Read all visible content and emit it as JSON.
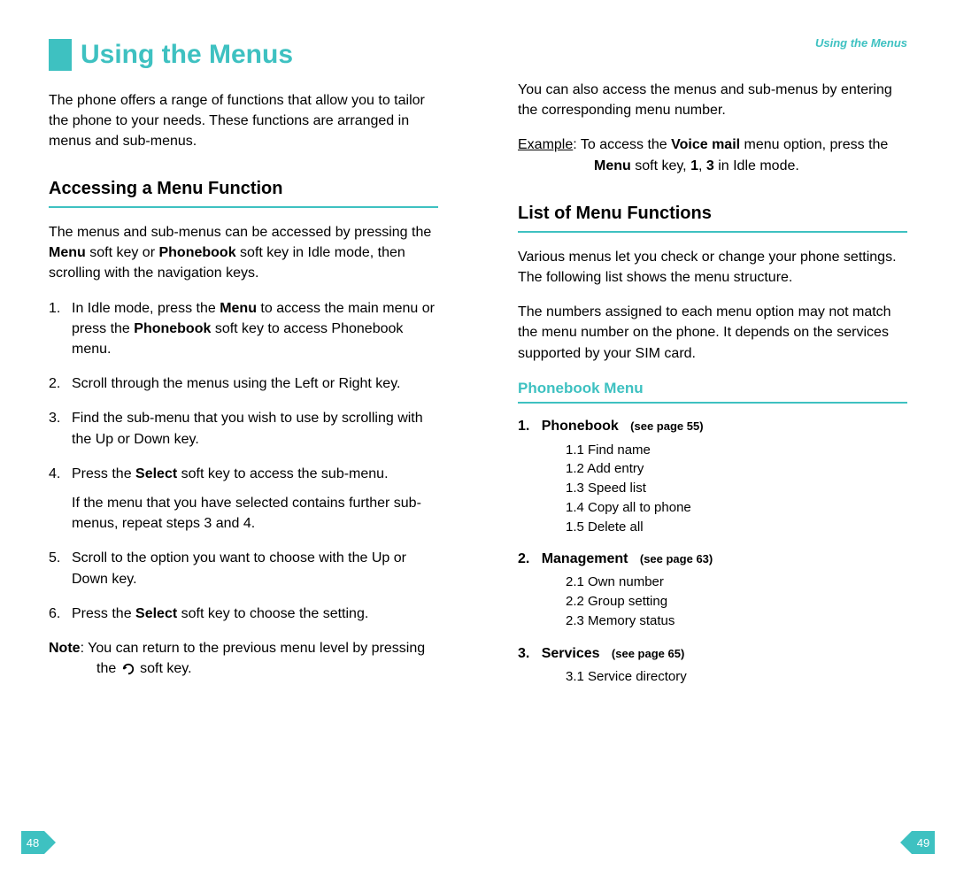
{
  "left": {
    "title": "Using the Menus",
    "intro": "The phone offers a range of functions that allow you to tailor the phone to your needs. These functions are arranged in menus and sub-menus.",
    "section_title": "Accessing a Menu Function",
    "access_para_prefix": "The menus and sub-menus can be accessed by pressing the ",
    "access_para_menu_bold": "Menu",
    "access_para_mid1": " soft key or ",
    "access_para_phonebook_bold": "Phonebook",
    "access_para_suffix": " soft key in Idle mode, then scrolling with the navigation keys.",
    "steps": [
      {
        "n": "1.",
        "pre": "In Idle mode, press the ",
        "b1": "Menu",
        "mid": " to access the main menu or press the ",
        "b2": "Phonebook",
        "post": " soft key to access Phonebook menu."
      },
      {
        "n": "2.",
        "text": "Scroll through the menus using the Left or Right key."
      },
      {
        "n": "3.",
        "text": "Find the sub-menu that you wish to use by scrolling with the Up or Down key."
      },
      {
        "n": "4.",
        "pre": "Press the ",
        "b1": "Select",
        "post": " soft key to access the sub-menu.",
        "sub": "If the menu that you have selected contains further sub-menus, repeat steps 3 and 4."
      },
      {
        "n": "5.",
        "text": "Scroll to the option you want to choose with the Up or Down key."
      },
      {
        "n": "6.",
        "pre": "Press the ",
        "b1": "Select",
        "post": " soft key to choose the setting."
      }
    ],
    "note_label": "Note",
    "note_text_pre": ": You can return to the previous menu level by pressing the ",
    "note_text_post": " soft key.",
    "page_number": "48"
  },
  "right": {
    "header": "Using the Menus",
    "para1": "You can also access the menus and sub-menus by entering the corresponding menu number.",
    "example_label": "Example",
    "example_pre": ": To access the ",
    "example_bold1": "Voice mail",
    "example_mid1": " menu option, press the ",
    "example_bold2": "Menu",
    "example_mid2": " soft key, ",
    "example_bold3": "1",
    "example_sep": ", ",
    "example_bold4": "3",
    "example_post": " in Idle mode.",
    "section_title": "List of Menu Functions",
    "list_para1": "Various menus let you check or change your phone settings. The following list shows the menu structure.",
    "list_para2": "The numbers assigned to each menu option may not match the menu number on the phone. It depends on the services supported by your SIM card.",
    "phonebook_group": "Phonebook Menu",
    "menus": [
      {
        "num": "1.",
        "title": "Phonebook",
        "ref": "(see page 55)",
        "items": [
          "1.1  Find name",
          "1.2  Add entry",
          "1.3  Speed list",
          "1.4  Copy all to phone",
          "1.5  Delete all"
        ]
      },
      {
        "num": "2.",
        "title": "Management",
        "ref": "(see page 63)",
        "items": [
          "2.1  Own number",
          "2.2  Group setting",
          "2.3  Memory status"
        ]
      },
      {
        "num": "3.",
        "title": "Services",
        "ref": "(see page 65)",
        "items": [
          "3.1  Service directory"
        ]
      }
    ],
    "page_number": "49"
  }
}
